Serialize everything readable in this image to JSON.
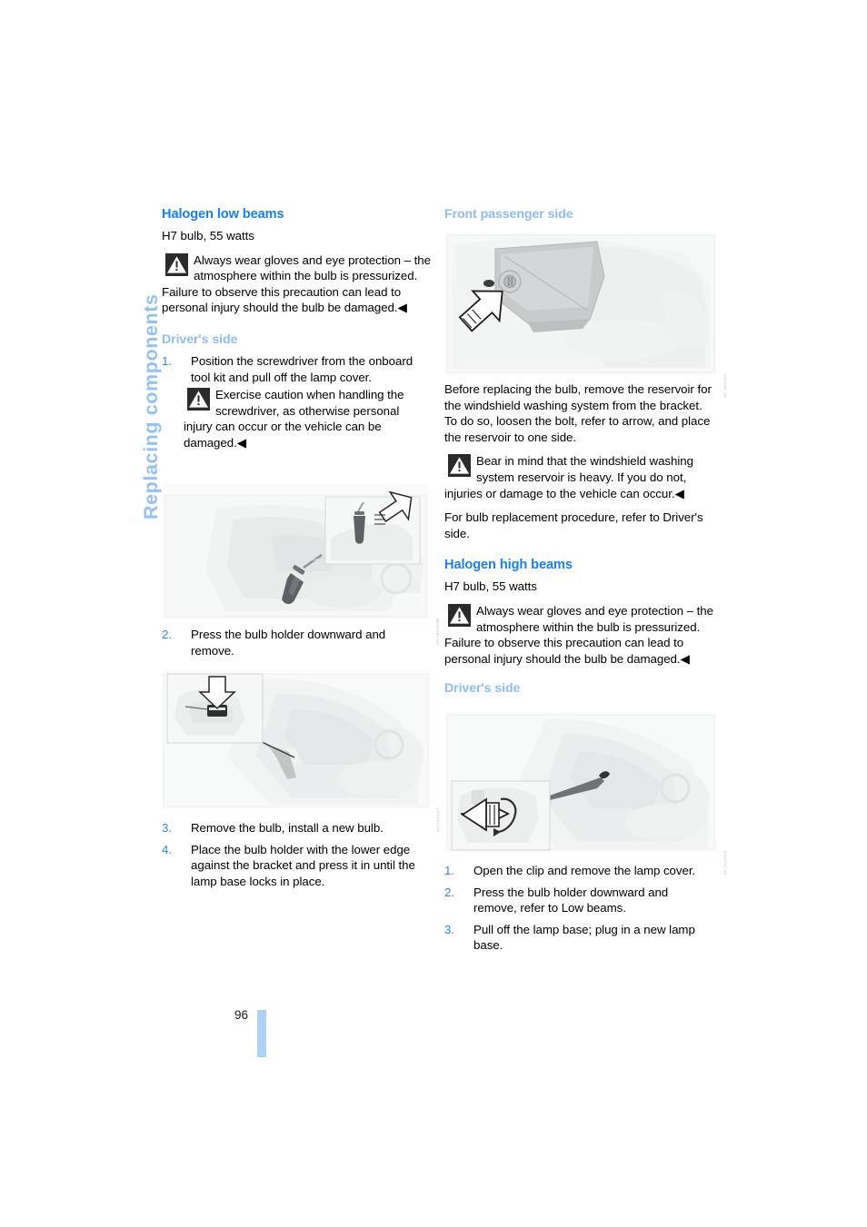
{
  "chapter": {
    "title": "Replacing components"
  },
  "page": {
    "number": "96"
  },
  "left_column": {
    "heading": "Halogen low beams",
    "spec": "H7 bulb, 55 watts",
    "warning_bulb": "Always wear gloves and eye protection – the atmosphere within the bulb is pressurized. Failure to observe this precaution can lead to personal injury should the bulb be damaged.",
    "subheading_driver": "Driver's side",
    "step_1": "Position the screwdriver from the onboard tool kit and pull off the lamp cover.",
    "warning_screwdriver": "Exercise caution when handling the screwdriver, as otherwise personal injury can occur or the vehicle can be damaged.",
    "step_2": "Press the bulb holder downward and remove.",
    "step_3": "Remove the bulb, install a new bulb.",
    "step_4": "Place the bulb holder with the lower edge against the bracket and press it in until the lamp base locks in place.",
    "figure_screwdriver_code": "WC18005WE",
    "figure_bulbholder_code": "WC2423WS"
  },
  "right_column": {
    "subheading_passenger": "Front passenger side",
    "figure_reservoir_code": "WC3650WS",
    "reservoir_text": "Before replacing the bulb, remove the reservoir for the windshield washing system from the bracket. To do so, loosen the bolt, refer to arrow, and place the reservoir to one side.",
    "warning_reservoir": "Bear in mind that the windshield washing system reservoir is heavy. If you do not, injuries or damage to the vehicle can occur.",
    "refer_text": "For bulb replacement procedure, refer to Driver's side.",
    "heading_high": "Halogen high beams",
    "spec": "H7 bulb, 55 watts",
    "warning_bulb": "Always wear gloves and eye protection – the atmosphere within the bulb is pressurized. Failure to observe this precaution can lead to personal injury should the bulb be damaged.",
    "subheading_driver": "Driver's side",
    "figure_highbeam_code": "WC3103WS",
    "step_1": "Open the clip and remove the lamp cover.",
    "step_2": "Press the bulb holder downward and remove, refer to Low beams.",
    "step_3": "Pull off the lamp base; plug in a new lamp base."
  },
  "symbols": {
    "end_of_warning": "◀",
    "warning_triangle": "warning-triangle-icon"
  },
  "colors": {
    "section_heading": "#1a7ff0",
    "sub_heading": "#8dbdf2",
    "chapter_rail": "#93c2f5",
    "list_number": "#2f87ef",
    "folio_bar": "#aed2f7"
  }
}
